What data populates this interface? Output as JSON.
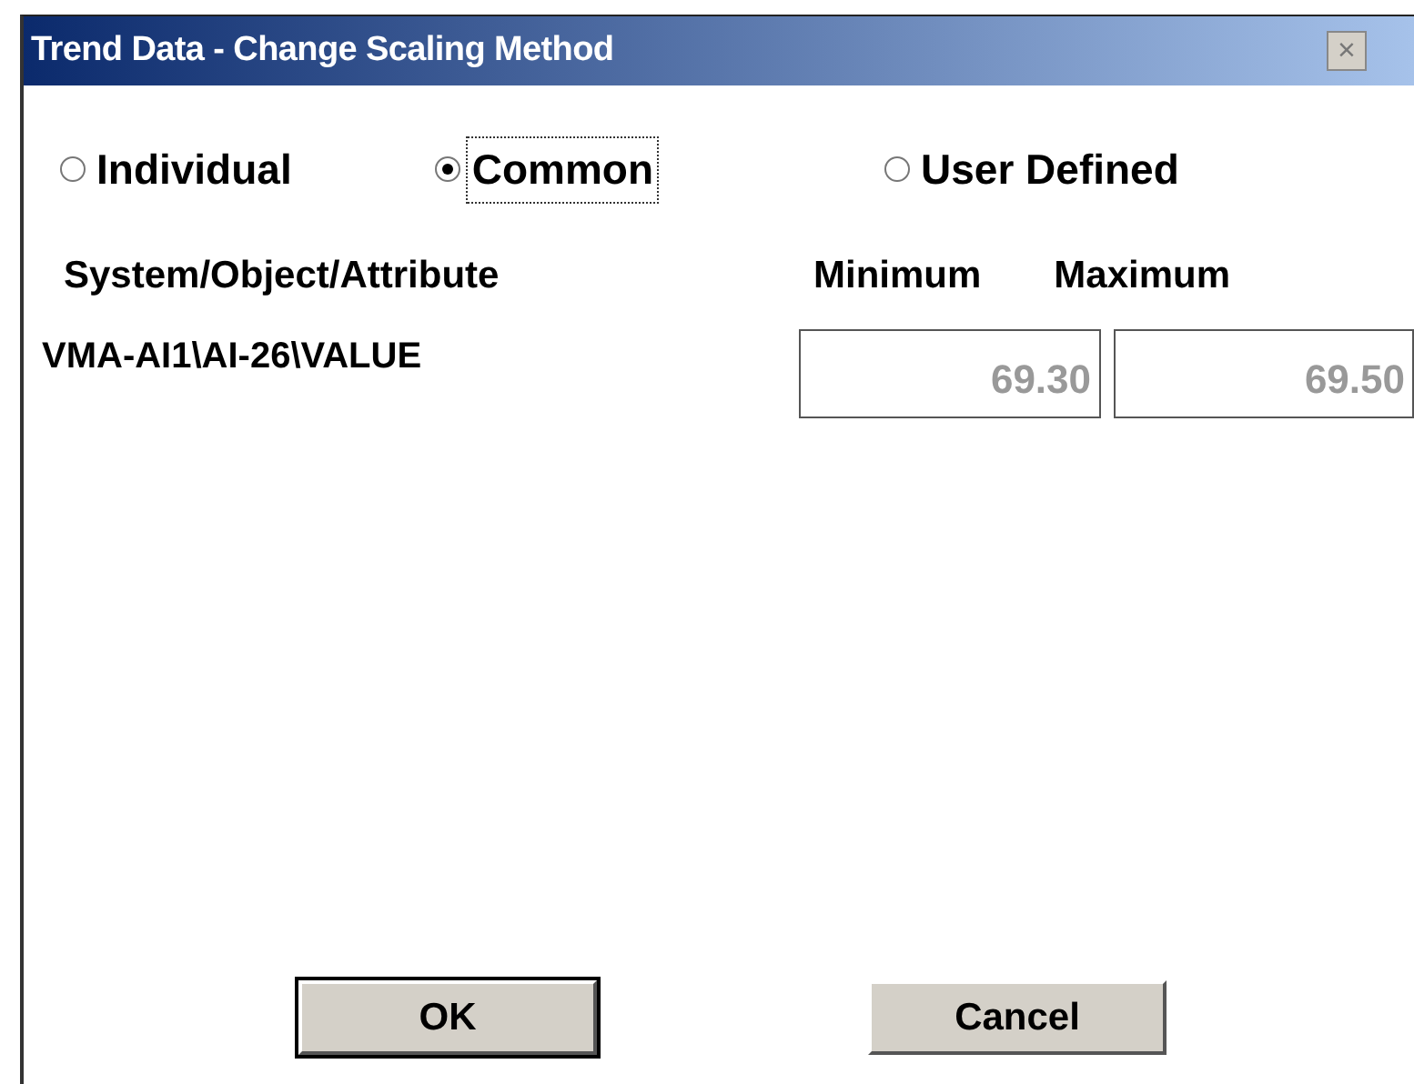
{
  "window": {
    "title": "Trend Data - Change Scaling Method",
    "close_label": "×"
  },
  "scaling_options": [
    {
      "label": "Individual",
      "selected": false,
      "focused": false
    },
    {
      "label": "Common",
      "selected": true,
      "focused": true
    },
    {
      "label": "User Defined",
      "selected": false,
      "focused": false
    }
  ],
  "table": {
    "columns": [
      "System/Object/Attribute",
      "Minimum",
      "Maximum"
    ],
    "rows": [
      {
        "name": "VMA-AI1\\AI-26\\VALUE",
        "minimum": "69.30",
        "maximum": "69.50",
        "disabled": true
      }
    ]
  },
  "buttons": [
    {
      "label": "OK",
      "default": true
    },
    {
      "label": "Cancel",
      "default": false
    }
  ]
}
